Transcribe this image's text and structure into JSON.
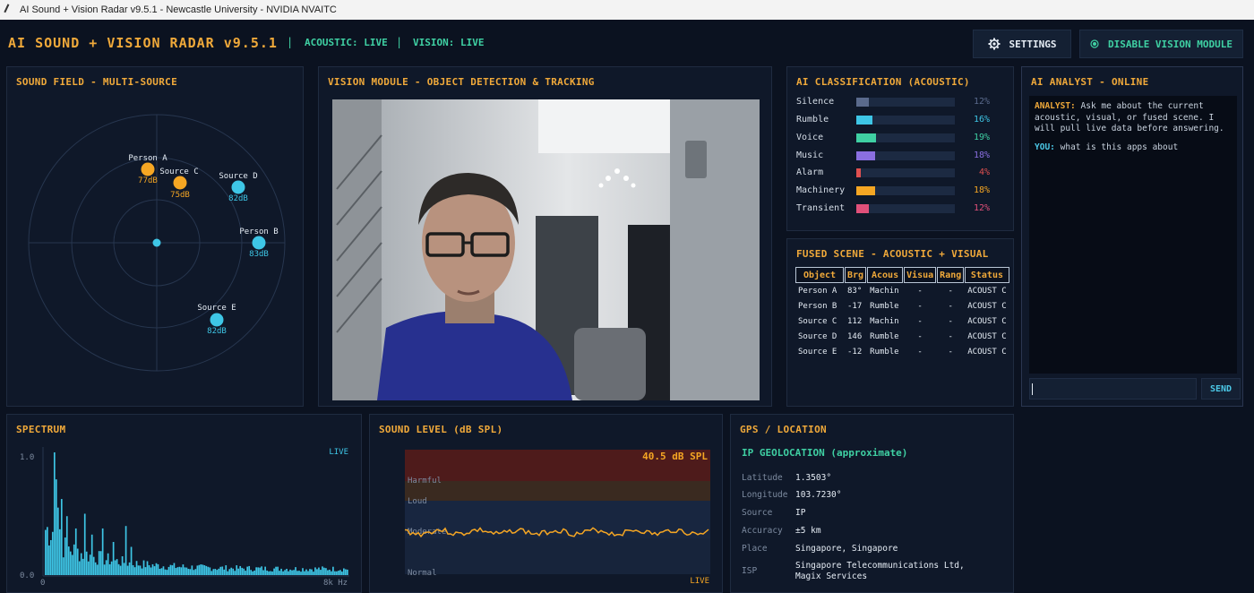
{
  "window": {
    "title": "AI Sound + Vision Radar v9.5.1 - Newcastle University - NVIDIA NVAITC"
  },
  "header": {
    "brand": "AI SOUND + VISION RADAR v9.5.1",
    "separator": "|",
    "acoustic_status": "ACOUSTIC: LIVE",
    "vision_status": "VISION: LIVE",
    "settings_label": "SETTINGS",
    "vision_toggle_label": "DISABLE VISION MODULE"
  },
  "sound_field": {
    "title": "SOUND FIELD - MULTI-SOURCE",
    "sources": [
      {
        "label": "Person A",
        "db": "77dB",
        "color": "#f5a623"
      },
      {
        "label": "Source C",
        "db": "75dB",
        "color": "#f5a623"
      },
      {
        "label": "Source D",
        "db": "82dB",
        "color": "#3ec6e6"
      },
      {
        "label": "Person B",
        "db": "83dB",
        "color": "#3ec6e6"
      },
      {
        "label": "Source E",
        "db": "82dB",
        "color": "#3ec6e6"
      }
    ]
  },
  "vision": {
    "title": "VISION MODULE - OBJECT DETECTION & TRACKING"
  },
  "classification": {
    "title": "AI CLASSIFICATION (ACOUSTIC)",
    "classes": [
      {
        "name": "Silence",
        "pct": "12%",
        "value": 12,
        "color": "#5a6a8c"
      },
      {
        "name": "Rumble",
        "pct": "16%",
        "value": 16,
        "color": "#3ec6e6"
      },
      {
        "name": "Voice",
        "pct": "19%",
        "value": 19,
        "color": "#3fd0a3"
      },
      {
        "name": "Music",
        "pct": "18%",
        "value": 18,
        "color": "#8a6fe0"
      },
      {
        "name": "Alarm",
        "pct": "4%",
        "value": 4,
        "color": "#e05050"
      },
      {
        "name": "Machinery",
        "pct": "18%",
        "value": 18,
        "color": "#f5a623"
      },
      {
        "name": "Transient",
        "pct": "12%",
        "value": 12,
        "color": "#e0507a"
      }
    ]
  },
  "fused": {
    "title": "FUSED SCENE - ACOUSTIC + VISUAL",
    "columns": [
      "Object",
      "Brg",
      "Acous",
      "Visua",
      "Rang",
      "Status"
    ],
    "rows": [
      [
        "Person A",
        "83°",
        "Machin",
        "-",
        "-",
        "ACOUST C"
      ],
      [
        "Person B",
        "-17",
        "Rumble",
        "-",
        "-",
        "ACOUST C"
      ],
      [
        "Source C",
        "112",
        "Machin",
        "-",
        "-",
        "ACOUST C"
      ],
      [
        "Source D",
        "146",
        "Rumble",
        "-",
        "-",
        "ACOUST C"
      ],
      [
        "Source E",
        "-12",
        "Rumble",
        "-",
        "-",
        "ACOUST C"
      ]
    ]
  },
  "analyst": {
    "title": "AI ANALYST - ONLINE",
    "analyst_label": "ANALYST:",
    "analyst_msg": "Ask me about the current acoustic, visual, or fused scene. I will pull live data before answering.",
    "you_label": "YOU:",
    "you_msg": "what is this apps about",
    "input_value": "",
    "send_label": "SEND"
  },
  "spectrum": {
    "title": "SPECTRUM",
    "live": "LIVE",
    "y_top": "1.0",
    "y_bottom": "0.0",
    "x_left": "0",
    "x_right": "8k Hz"
  },
  "level": {
    "title": "SOUND LEVEL (dB SPL)",
    "reading": "40.5 dB SPL",
    "zones": [
      "Harmful",
      "Loud",
      "Moderate",
      "Normal"
    ],
    "live": "LIVE",
    "value": 40.5
  },
  "gps": {
    "title": "GPS / LOCATION",
    "subtitle": "IP GEOLOCATION (approximate)",
    "rows": [
      {
        "key": "Latitude",
        "value": "1.3503°"
      },
      {
        "key": "Longitude",
        "value": "103.7230°"
      },
      {
        "key": "Source",
        "value": "IP"
      },
      {
        "key": "Accuracy",
        "value": "±5 km"
      },
      {
        "key": "Place",
        "value": "Singapore, Singapore"
      },
      {
        "key": "ISP",
        "value": "Singapore Telecommunications Ltd, Magix Services"
      }
    ]
  }
}
